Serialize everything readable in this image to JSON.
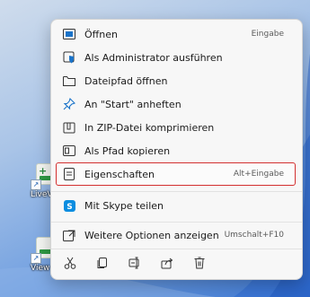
{
  "desktop": {
    "icons": [
      {
        "label": "LiveV",
        "icon": "excel-shortcut-icon"
      },
      {
        "label": "View",
        "icon": "excel-shortcut-icon"
      }
    ]
  },
  "context_menu": {
    "items": [
      {
        "label": "Öffnen",
        "shortcut": "Eingabe",
        "icon": "open-icon"
      },
      {
        "label": "Als Administrator ausführen",
        "shortcut": "",
        "icon": "shield-admin-icon"
      },
      {
        "label": "Dateipfad öffnen",
        "shortcut": "",
        "icon": "folder-icon"
      },
      {
        "label": "An \"Start\" anheften",
        "shortcut": "",
        "icon": "pin-icon"
      },
      {
        "label": "In ZIP-Datei komprimieren",
        "shortcut": "",
        "icon": "zip-icon"
      },
      {
        "label": "Als Pfad kopieren",
        "shortcut": "",
        "icon": "copy-path-icon"
      },
      {
        "label": "Eigenschaften",
        "shortcut": "Alt+Eingabe",
        "icon": "properties-icon"
      },
      {
        "label": "Mit Skype teilen",
        "shortcut": "",
        "icon": "skype-icon"
      },
      {
        "label": "Weitere Optionen anzeigen",
        "shortcut": "Umschalt+F10",
        "icon": "more-options-icon"
      }
    ],
    "actions": [
      {
        "name": "cut-icon"
      },
      {
        "name": "copy-icon"
      },
      {
        "name": "rename-icon"
      },
      {
        "name": "share-icon"
      },
      {
        "name": "delete-icon"
      }
    ],
    "highlight_color": "#d32f2f",
    "accent_color": "#1a73c9"
  }
}
